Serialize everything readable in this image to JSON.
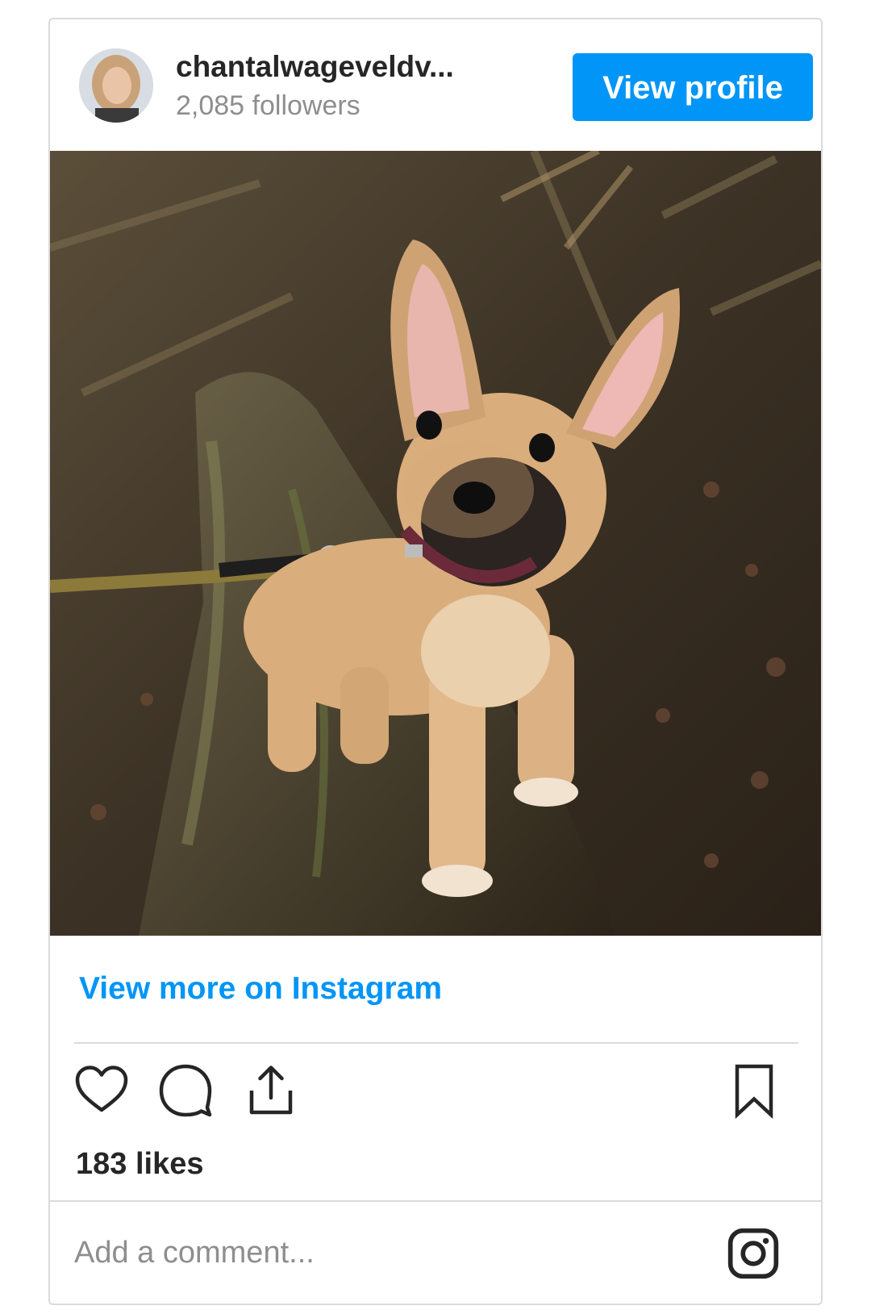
{
  "header": {
    "username": "chantalwageveldv...",
    "followers": "2,085 followers",
    "view_profile_label": "View profile"
  },
  "post": {
    "view_more_label": "View more on Instagram",
    "likes": "183 likes",
    "comment_placeholder": "Add a comment..."
  },
  "icons": {
    "like": "heart-icon",
    "comment": "comment-icon",
    "share": "share-icon",
    "save": "bookmark-icon",
    "brand": "instagram-icon"
  },
  "colors": {
    "accent": "#0095f6",
    "text": "#262626",
    "muted": "#8e8e8e",
    "border": "#dbdbdb"
  }
}
